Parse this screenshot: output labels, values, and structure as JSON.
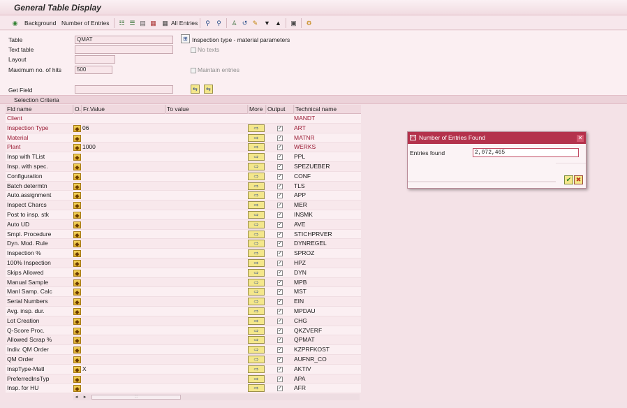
{
  "window": {
    "title": "General Table Display"
  },
  "toolbar": {
    "execute_icon": "execute-icon",
    "background_label": "Background",
    "number_of_entries_label": "Number of Entries",
    "all_entries_label": "All Entries"
  },
  "header": {
    "table_label": "Table",
    "table_value": "QMAT",
    "table_description": "Inspection type - material parameters",
    "text_table_label": "Text table",
    "text_table_value": "",
    "no_texts_label": "No texts",
    "layout_label": "Layout",
    "layout_value": "",
    "max_hits_label": "Maximum no. of hits",
    "max_hits_value": "500",
    "maintain_entries_label": "Maintain entries",
    "get_field_label": "Get Field",
    "get_field_value": ""
  },
  "selection": {
    "section_title": "Selection Criteria",
    "columns": {
      "fld_name": "Fld name",
      "op": "O.",
      "fr_value": "Fr.Value",
      "to_value": "To value",
      "more": "More",
      "output": "Output",
      "technical": "Technical name"
    },
    "rows": [
      {
        "name": "Client",
        "fr": "",
        "tech": "MANDT",
        "key": true,
        "op": false,
        "more": false,
        "out": false
      },
      {
        "name": "Inspection Type",
        "fr": "06",
        "tech": "ART",
        "key": true,
        "op": true,
        "more": true,
        "out": true
      },
      {
        "name": "Material",
        "fr": "",
        "tech": "MATNR",
        "key": true,
        "op": true,
        "more": true,
        "out": true
      },
      {
        "name": "Plant",
        "fr": "1000",
        "tech": "WERKS",
        "key": true,
        "op": true,
        "more": true,
        "out": true
      },
      {
        "name": "Insp with TList",
        "fr": "",
        "tech": "PPL",
        "key": false,
        "op": true,
        "more": true,
        "out": true
      },
      {
        "name": "Insp. with spec.",
        "fr": "",
        "tech": "SPEZUEBER",
        "key": false,
        "op": true,
        "more": true,
        "out": true
      },
      {
        "name": "Configuration",
        "fr": "",
        "tech": "CONF",
        "key": false,
        "op": true,
        "more": true,
        "out": true
      },
      {
        "name": "Batch determtn",
        "fr": "",
        "tech": "TLS",
        "key": false,
        "op": true,
        "more": true,
        "out": true
      },
      {
        "name": "Auto.assignment",
        "fr": "",
        "tech": "APP",
        "key": false,
        "op": true,
        "more": true,
        "out": true
      },
      {
        "name": "Inspect Charcs",
        "fr": "",
        "tech": "MER",
        "key": false,
        "op": true,
        "more": true,
        "out": true
      },
      {
        "name": "Post to insp. stk",
        "fr": "",
        "tech": "INSMK",
        "key": false,
        "op": true,
        "more": true,
        "out": true
      },
      {
        "name": "Auto UD",
        "fr": "",
        "tech": "AVE",
        "key": false,
        "op": true,
        "more": true,
        "out": true
      },
      {
        "name": "Smpl. Procedure",
        "fr": "",
        "tech": "STICHPRVER",
        "key": false,
        "op": true,
        "more": true,
        "out": true
      },
      {
        "name": "Dyn. Mod. Rule",
        "fr": "",
        "tech": "DYNREGEL",
        "key": false,
        "op": true,
        "more": true,
        "out": true
      },
      {
        "name": "Inspection %",
        "fr": "",
        "tech": "SPROZ",
        "key": false,
        "op": true,
        "more": true,
        "out": true
      },
      {
        "name": "100% Inspection",
        "fr": "",
        "tech": "HPZ",
        "key": false,
        "op": true,
        "more": true,
        "out": true
      },
      {
        "name": "Skips Allowed",
        "fr": "",
        "tech": "DYN",
        "key": false,
        "op": true,
        "more": true,
        "out": true
      },
      {
        "name": "Manual Sample",
        "fr": "",
        "tech": "MPB",
        "key": false,
        "op": true,
        "more": true,
        "out": true
      },
      {
        "name": "Manl Samp. Calc",
        "fr": "",
        "tech": "MST",
        "key": false,
        "op": true,
        "more": true,
        "out": true
      },
      {
        "name": "Serial Numbers",
        "fr": "",
        "tech": "EIN",
        "key": false,
        "op": true,
        "more": true,
        "out": true
      },
      {
        "name": "Avg. insp. dur.",
        "fr": "",
        "tech": "MPDAU",
        "key": false,
        "op": true,
        "more": true,
        "out": true
      },
      {
        "name": "Lot Creation",
        "fr": "",
        "tech": "CHG",
        "key": false,
        "op": true,
        "more": true,
        "out": true
      },
      {
        "name": "Q-Score Proc.",
        "fr": "",
        "tech": "QKZVERF",
        "key": false,
        "op": true,
        "more": true,
        "out": true
      },
      {
        "name": "Allowed Scrap %",
        "fr": "",
        "tech": "QPMAT",
        "key": false,
        "op": true,
        "more": true,
        "out": true
      },
      {
        "name": "Indiv. QM Order",
        "fr": "",
        "tech": "KZPRFKOST",
        "key": false,
        "op": true,
        "more": true,
        "out": true
      },
      {
        "name": "QM Order",
        "fr": "",
        "tech": "AUFNR_CO",
        "key": false,
        "op": true,
        "more": true,
        "out": true
      },
      {
        "name": "InspType-Matl",
        "fr": "X",
        "tech": "AKTIV",
        "key": false,
        "op": true,
        "more": true,
        "out": true
      },
      {
        "name": "PreferredInsTyp",
        "fr": "",
        "tech": "APA",
        "key": false,
        "op": true,
        "more": true,
        "out": true
      },
      {
        "name": "Insp. for HU",
        "fr": "",
        "tech": "AFR",
        "key": false,
        "op": true,
        "more": true,
        "out": true
      }
    ]
  },
  "dialog": {
    "title": "Number of Entries Found",
    "entries_label": "Entries found",
    "entries_value": "2,072,465"
  }
}
